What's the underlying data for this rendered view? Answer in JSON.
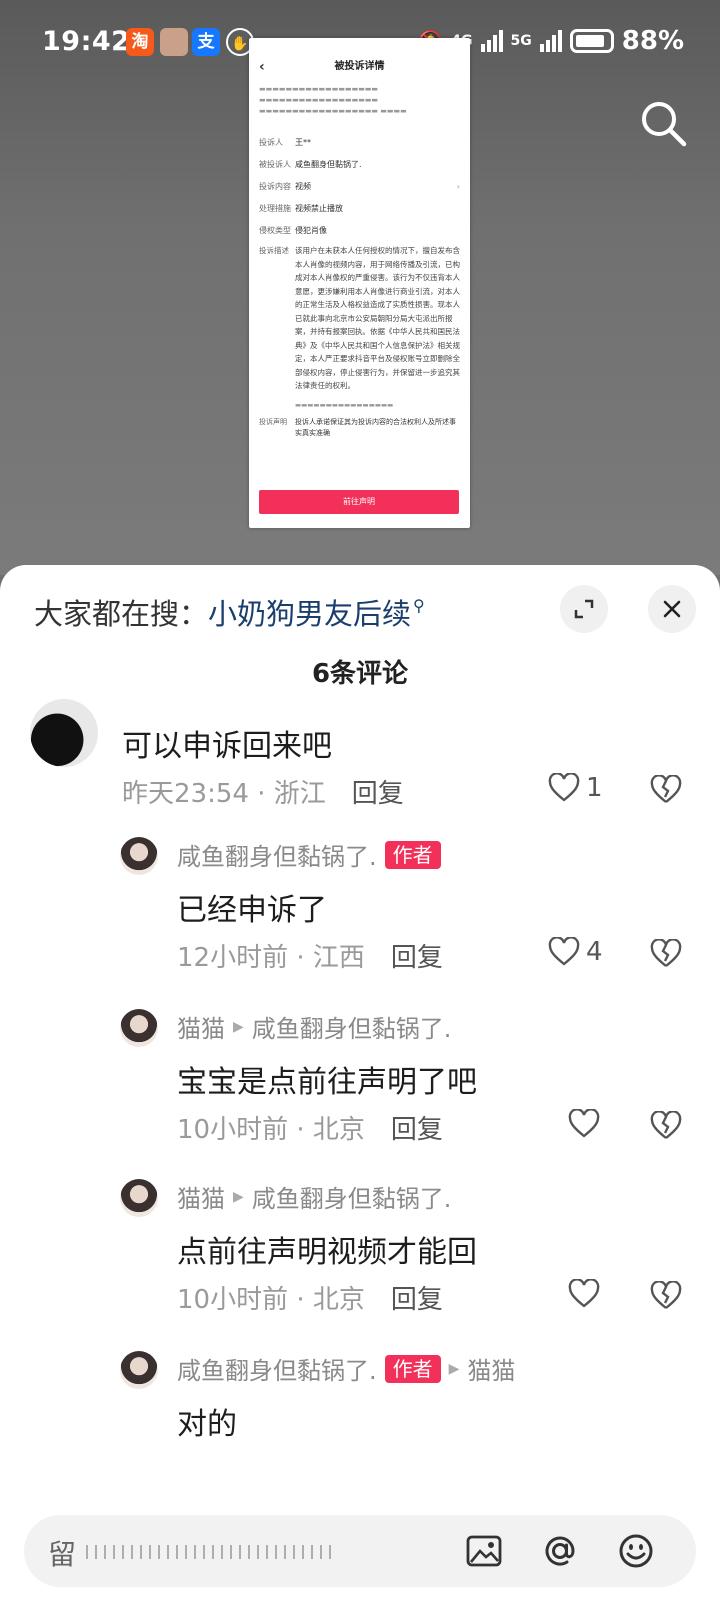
{
  "status_bar": {
    "time": "19:42",
    "apps": [
      "淘",
      "支"
    ],
    "network1": "4G",
    "network2": "5G",
    "battery": "88%"
  },
  "doc": {
    "title": "被投诉详情",
    "rows": [
      {
        "k": "投诉人",
        "v": "王**"
      },
      {
        "k": "被投诉人",
        "v": "咸鱼翻身但黏锅了."
      },
      {
        "k": "投诉内容",
        "v": "视频"
      },
      {
        "k": "处理措施",
        "v": "视频禁止播放"
      },
      {
        "k": "侵权类型",
        "v": "侵犯肖像"
      }
    ],
    "desc_key": "投诉描述",
    "desc": "该用户在未获本人任何授权的情况下，擅自发布含本人肖像的视频内容，用于网络传播及引流，已构成对本人肖像权的严重侵害。该行为不仅违背本人意愿，更涉嫌利用本人肖像进行商业引流，对本人的正常生活及人格权益造成了实质性损害。现本人已就此事向北京市公安局朝阳分局大屯派出所报案，并持有报案回执。依据《中华人民共和国民法典》及《中华人民共和国个人信息保护法》相关规定，本人严正要求抖音平台及侵权账号立即删除全部侵权内容，停止侵害行为，并保留进一步追究其法律责任的权利。",
    "statement_key": "投诉声明",
    "statement": "投诉人承诺保证其为投诉内容的合法权利人及所述事实真实准确",
    "button": "前往声明"
  },
  "sheet": {
    "trending_prefix": "大家都在搜：",
    "trending_term": "小奶狗男友后续",
    "count_label": "6条评论"
  },
  "comments": [
    {
      "text": "可以申诉回来吧",
      "time": "昨天23:54",
      "loc": "浙江",
      "reply": "回复",
      "likes": "1"
    },
    {
      "user": "咸鱼翻身但黏锅了.",
      "tag": "作者",
      "text": "已经申诉了",
      "time": "12小时前",
      "loc": "江西",
      "reply": "回复",
      "likes": "4"
    },
    {
      "user": "猫猫",
      "to": "咸鱼翻身但黏锅了.",
      "text": "宝宝是点前往声明了吧",
      "time": "10小时前",
      "loc": "北京",
      "reply": "回复"
    },
    {
      "user": "猫猫",
      "to": "咸鱼翻身但黏锅了.",
      "text": "点前往声明视频才能回",
      "time": "10小时前",
      "loc": "北京",
      "reply": "回复"
    },
    {
      "user": "咸鱼翻身但黏锅了.",
      "tag": "作者",
      "to": "猫猫",
      "text": "对的"
    }
  ],
  "input": {
    "placeholder": "留"
  },
  "icons": {
    "search": "search-icon",
    "expand": "expand-icon",
    "close": "close-icon",
    "like": "heart-icon",
    "dislike": "broken-heart-icon",
    "image": "image-icon",
    "at": "at-icon",
    "emoji": "emoji-icon"
  },
  "colors": {
    "author_tag": "#f2305a",
    "trending_term": "#1a3f6e",
    "doc_button": "#f2305a"
  }
}
